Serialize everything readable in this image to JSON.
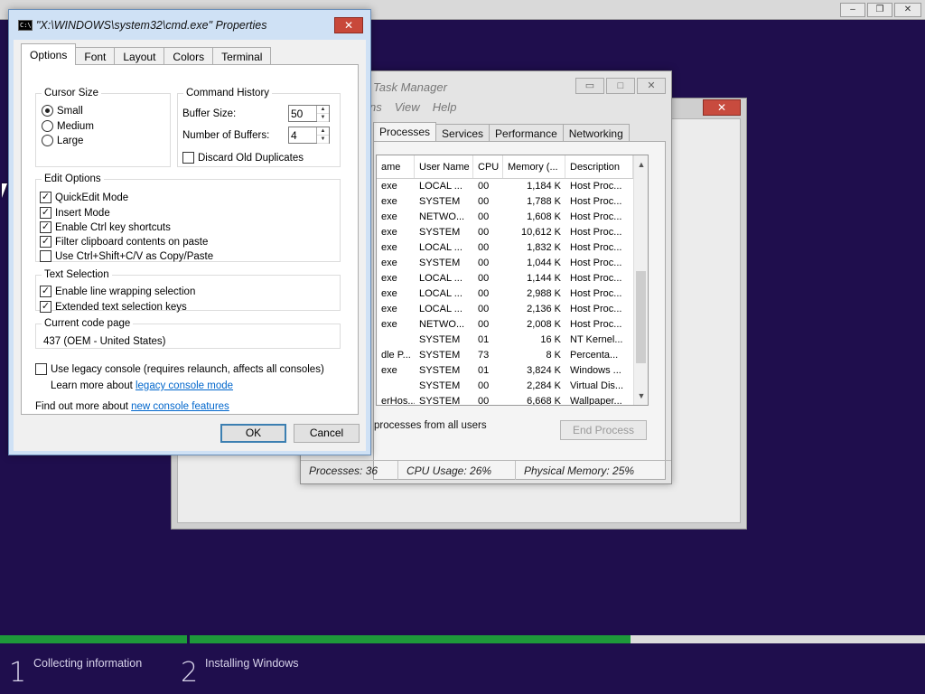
{
  "setup": {
    "caption_buttons": [
      "–",
      "❐",
      "✕"
    ],
    "progress": [
      1.0,
      0.6
    ],
    "steps": [
      {
        "number": "1",
        "label": "Collecting information"
      },
      {
        "number": "2",
        "label": "Installing Windows"
      }
    ]
  },
  "ghost_window": {
    "close": "✕"
  },
  "task_manager": {
    "title": "Task Manager",
    "caption_buttons": [
      "▭",
      "□",
      "✕"
    ],
    "menu": [
      "ns",
      "View",
      "Help"
    ],
    "tabs": [
      "Processes",
      "Services",
      "Performance",
      "Networking"
    ],
    "columns": [
      "ame",
      "User Name",
      "CPU",
      "Memory (...",
      "Description"
    ],
    "rows": [
      {
        "name": "exe",
        "user": "LOCAL ...",
        "cpu": "00",
        "mem": "1,184 K",
        "desc": "Host Proc..."
      },
      {
        "name": "exe",
        "user": "SYSTEM",
        "cpu": "00",
        "mem": "1,788 K",
        "desc": "Host Proc..."
      },
      {
        "name": "exe",
        "user": "NETWO...",
        "cpu": "00",
        "mem": "1,608 K",
        "desc": "Host Proc..."
      },
      {
        "name": "exe",
        "user": "SYSTEM",
        "cpu": "00",
        "mem": "10,612 K",
        "desc": "Host Proc..."
      },
      {
        "name": "exe",
        "user": "LOCAL ...",
        "cpu": "00",
        "mem": "1,832 K",
        "desc": "Host Proc..."
      },
      {
        "name": "exe",
        "user": "SYSTEM",
        "cpu": "00",
        "mem": "1,044 K",
        "desc": "Host Proc..."
      },
      {
        "name": "exe",
        "user": "LOCAL ...",
        "cpu": "00",
        "mem": "1,144 K",
        "desc": "Host Proc..."
      },
      {
        "name": "exe",
        "user": "LOCAL ...",
        "cpu": "00",
        "mem": "2,988 K",
        "desc": "Host Proc..."
      },
      {
        "name": "exe",
        "user": "LOCAL ...",
        "cpu": "00",
        "mem": "2,136 K",
        "desc": "Host Proc..."
      },
      {
        "name": "exe",
        "user": "NETWO...",
        "cpu": "00",
        "mem": "2,008 K",
        "desc": "Host Proc..."
      },
      {
        "name": "",
        "user": "SYSTEM",
        "cpu": "01",
        "mem": "16 K",
        "desc": "NT Kernel..."
      },
      {
        "name": "dle P...",
        "user": "SYSTEM",
        "cpu": "73",
        "mem": "8 K",
        "desc": "Percenta..."
      },
      {
        "name": "exe",
        "user": "SYSTEM",
        "cpu": "01",
        "mem": "3,824 K",
        "desc": "Windows ..."
      },
      {
        "name": "",
        "user": "SYSTEM",
        "cpu": "00",
        "mem": "2,284 K",
        "desc": "Virtual Dis..."
      },
      {
        "name": "erHos...",
        "user": "SYSTEM",
        "cpu": "00",
        "mem": "6,668 K",
        "desc": "Wallpaper..."
      }
    ],
    "scroll_up": "▲",
    "scroll_down": "▼",
    "show_all": "processes from all users",
    "end_process": "End Process",
    "status": {
      "processes": "Processes: 36",
      "cpu": "CPU Usage: 26%",
      "memory": "Physical Memory: 25%"
    }
  },
  "dialog": {
    "icon_text": "C:\\",
    "title": "\"X:\\WINDOWS\\system32\\cmd.exe\" Properties",
    "close": "✕",
    "tabs": [
      "Options",
      "Font",
      "Layout",
      "Colors",
      "Terminal"
    ],
    "cursor_size": {
      "legend": "Cursor Size",
      "options": [
        {
          "label": "Small",
          "checked": true
        },
        {
          "label": "Medium",
          "checked": false
        },
        {
          "label": "Large",
          "checked": false
        }
      ]
    },
    "command_history": {
      "legend": "Command History",
      "buffer_size_label": "Buffer Size:",
      "buffer_size": "50",
      "buffers_label": "Number of Buffers:",
      "buffers": "4",
      "discard_label": "Discard Old Duplicates",
      "discard_checked": false,
      "spin_up": "▲",
      "spin_down": "▼"
    },
    "edit_options": {
      "legend": "Edit Options",
      "items": [
        {
          "label": "QuickEdit Mode",
          "checked": true
        },
        {
          "label": "Insert Mode",
          "checked": true
        },
        {
          "label": "Enable Ctrl key shortcuts",
          "checked": true
        },
        {
          "label": "Filter clipboard contents on paste",
          "checked": true
        },
        {
          "label": "Use Ctrl+Shift+C/V as Copy/Paste",
          "checked": false
        }
      ]
    },
    "text_selection": {
      "legend": "Text Selection",
      "items": [
        {
          "label": "Enable line wrapping selection",
          "checked": true
        },
        {
          "label": "Extended text selection keys",
          "checked": true
        }
      ]
    },
    "code_page": {
      "legend": "Current code page",
      "value": "437   (OEM - United States)"
    },
    "legacy": {
      "label": "Use legacy console (requires relaunch, affects all consoles)",
      "checked": false
    },
    "learn_more": {
      "prefix": "Learn more about ",
      "link": "legacy console mode"
    },
    "find_out": {
      "prefix": "Find out more about ",
      "link": "new console features"
    },
    "ok": "OK",
    "cancel": "Cancel",
    "check_mark": "✓"
  }
}
